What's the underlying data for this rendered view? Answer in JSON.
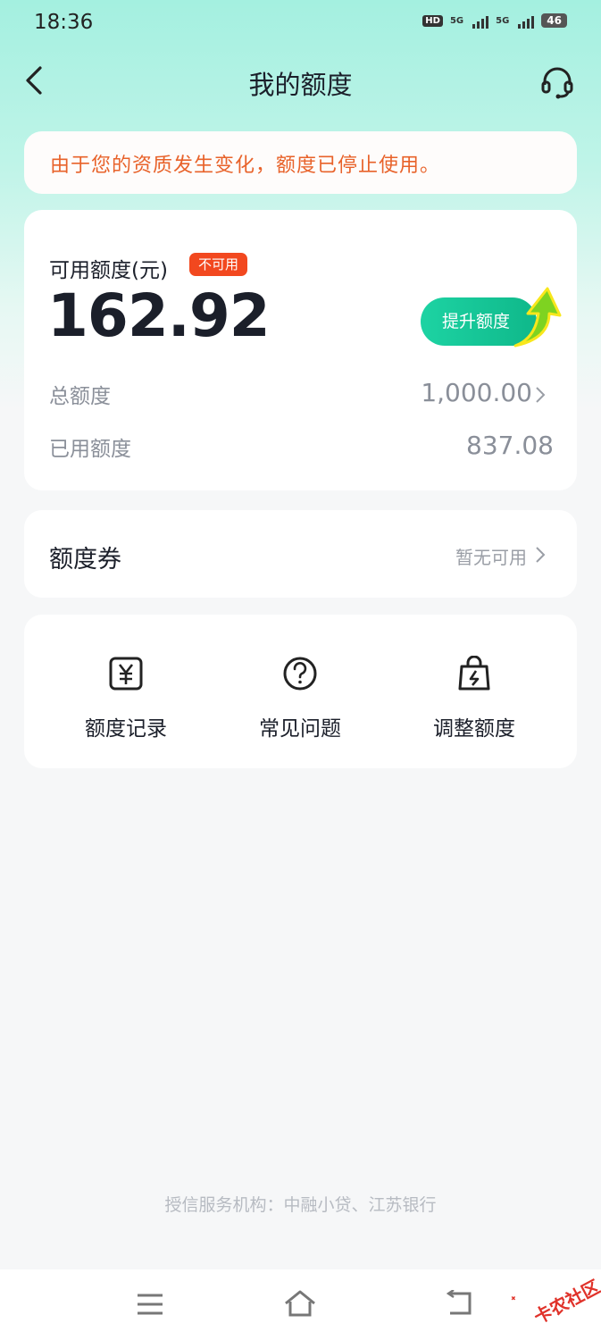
{
  "status_bar": {
    "time": "18:36",
    "hd_label": "HD",
    "sim1_label": "5G",
    "sim2_label": "5G",
    "battery": "46"
  },
  "header": {
    "title": "我的额度"
  },
  "notice": {
    "text": "由于您的资质发生变化，额度已停止使用。"
  },
  "quota": {
    "available_label": "可用额度(元)",
    "status_badge": "不可用",
    "available_amount": "162.92",
    "raise_button": "提升额度",
    "total_label": "总额度",
    "total_value": "1,000.00",
    "used_label": "已用额度",
    "used_value": "837.08"
  },
  "coupon": {
    "title": "额度券",
    "status": "暂无可用"
  },
  "menu": [
    {
      "label": "额度记录",
      "icon": "yuan-record-icon"
    },
    {
      "label": "常见问题",
      "icon": "question-icon"
    },
    {
      "label": "调整额度",
      "icon": "lightning-bag-icon"
    }
  ],
  "footer": {
    "note": "授信服务机构：中融小贷、江苏银行"
  },
  "watermark": {
    "text": "卡农社区"
  },
  "colors": {
    "accent_green": "#1dd3a3",
    "notice_orange": "#e8622a",
    "badge_red": "#f2481f",
    "header_bg": "#a4f0e0"
  }
}
